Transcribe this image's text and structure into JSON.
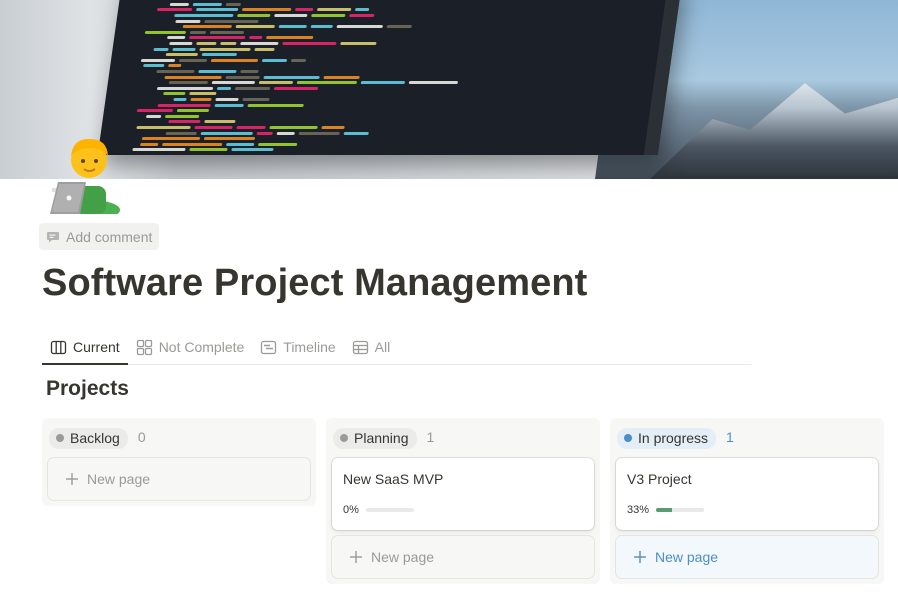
{
  "page": {
    "title": "Software Project Management",
    "icon": "man-technologist-emoji",
    "cover": "laptop-code-editor-mountain-photo",
    "add_comment_label": "Add comment"
  },
  "tabs": [
    {
      "label": "Current",
      "icon": "board-icon",
      "active": true
    },
    {
      "label": "Not Complete",
      "icon": "gallery-icon",
      "active": false
    },
    {
      "label": "Timeline",
      "icon": "timeline-icon",
      "active": false
    },
    {
      "label": "All",
      "icon": "table-icon",
      "active": false
    }
  ],
  "section_title": "Projects",
  "columns": [
    {
      "status": "Backlog",
      "count": "0",
      "dot_color": "#9b9a97",
      "pill_bg": "#ebebea",
      "cards": [],
      "new_page_label": "New page"
    },
    {
      "status": "Planning",
      "count": "1",
      "dot_color": "#9b9a97",
      "pill_bg": "#ebebea",
      "cards": [
        {
          "title": "New SaaS MVP",
          "progress_label": "0%",
          "progress": 0
        }
      ],
      "new_page_label": "New page"
    },
    {
      "status": "In progress",
      "count": "1",
      "dot_color": "#4b8ec9",
      "pill_bg": "#e3eef7",
      "cards": [
        {
          "title": "V3 Project",
          "progress_label": "33%",
          "progress": 0.33
        }
      ],
      "new_page_label": "New page"
    }
  ],
  "colors": {
    "accent_blue": "#4b8ec9",
    "progress_green": "#5a9b73"
  }
}
